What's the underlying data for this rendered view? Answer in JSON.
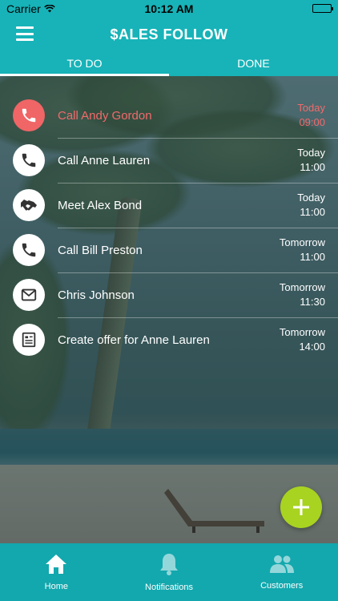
{
  "status_bar": {
    "carrier": "Carrier",
    "time": "10:12 AM"
  },
  "header": {
    "title": "$ALES FOLLOW",
    "menu_icon": "hamburger-menu-icon"
  },
  "tabs": [
    {
      "label": "TO DO",
      "active": true
    },
    {
      "label": "DONE",
      "active": false
    }
  ],
  "tasks": [
    {
      "icon": "phone-icon",
      "title": "Call Andy Gordon",
      "day": "Today",
      "time": "09:00",
      "overdue": true
    },
    {
      "icon": "phone-icon",
      "title": "Call Anne Lauren",
      "day": "Today",
      "time": "11:00",
      "overdue": false
    },
    {
      "icon": "handshake-icon",
      "title": "Meet Alex Bond",
      "day": "Today",
      "time": "11:00",
      "overdue": false
    },
    {
      "icon": "phone-icon",
      "title": "Call Bill Preston",
      "day": "Tomorrow",
      "time": "11:00",
      "overdue": false
    },
    {
      "icon": "mail-icon",
      "title": "Chris Johnson",
      "day": "Tomorrow",
      "time": "11:30",
      "overdue": false
    },
    {
      "icon": "document-icon",
      "title": "Create offer for Anne Lauren",
      "day": "Tomorrow",
      "time": "14:00",
      "overdue": false
    }
  ],
  "fab": {
    "icon": "plus-icon",
    "color": "#a8d321"
  },
  "bottom_nav": [
    {
      "label": "Home",
      "icon": "home-icon",
      "active": true
    },
    {
      "label": "Notifications",
      "icon": "bell-icon",
      "active": false
    },
    {
      "label": "Customers",
      "icon": "people-icon",
      "active": false
    }
  ],
  "colors": {
    "brand": "#17b3b8",
    "overdue": "#f26a6b",
    "fab": "#a8d321"
  }
}
